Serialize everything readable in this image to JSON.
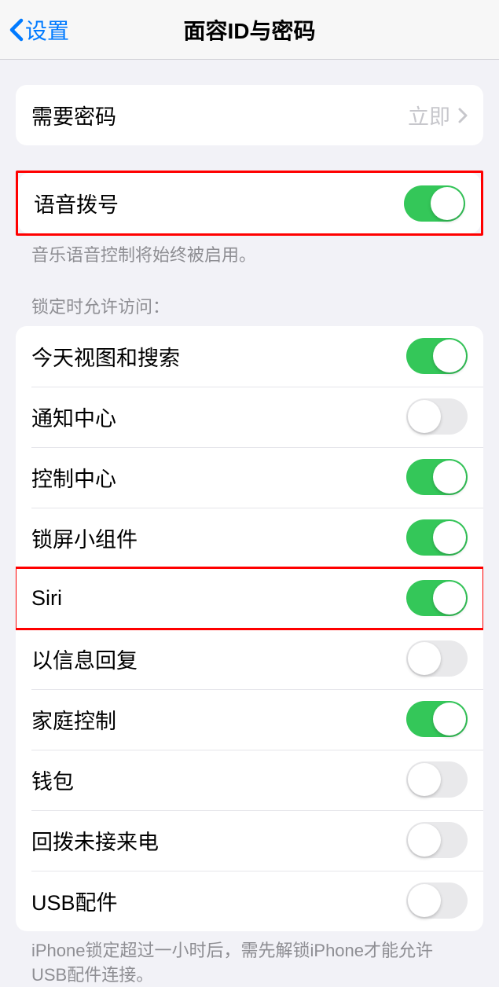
{
  "nav": {
    "back_label": "设置",
    "title": "面容ID与密码"
  },
  "require_passcode": {
    "label": "需要密码",
    "value": "立即"
  },
  "voice_dial": {
    "label": "语音拨号",
    "footer": "音乐语音控制将始终被启用。"
  },
  "lock_access": {
    "header": "锁定时允许访问：",
    "items": [
      {
        "label": "今天视图和搜索",
        "on": true
      },
      {
        "label": "通知中心",
        "on": false
      },
      {
        "label": "控制中心",
        "on": true
      },
      {
        "label": "锁屏小组件",
        "on": true
      },
      {
        "label": "Siri",
        "on": true
      },
      {
        "label": "以信息回复",
        "on": false
      },
      {
        "label": "家庭控制",
        "on": true
      },
      {
        "label": "钱包",
        "on": false
      },
      {
        "label": "回拨未接来电",
        "on": false
      },
      {
        "label": "USB配件",
        "on": false
      }
    ],
    "footer": "iPhone锁定超过一小时后，需先解锁iPhone才能允许USB配件连接。"
  }
}
